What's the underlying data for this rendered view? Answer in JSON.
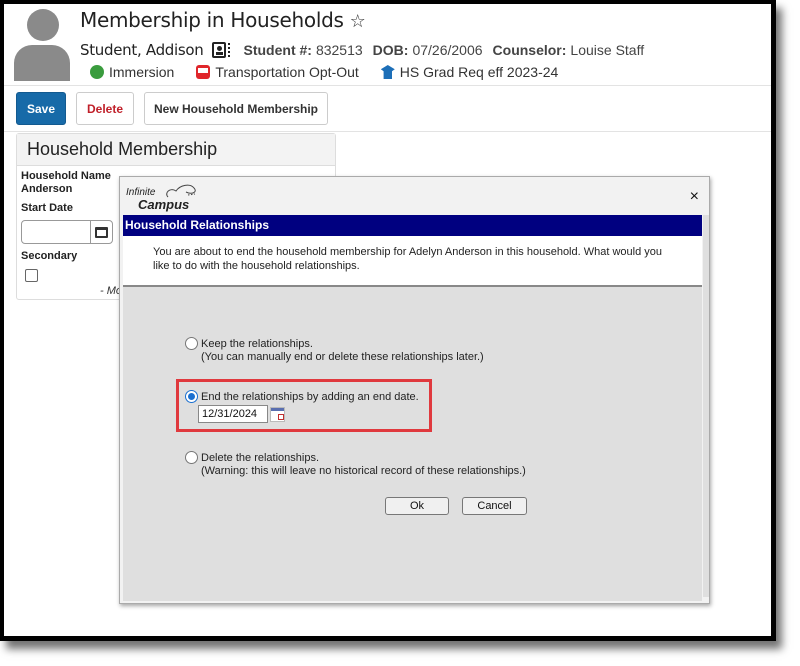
{
  "header": {
    "page_title": "Membership in Households",
    "favorite_icon": "star-outline-icon",
    "student_name": "Student, Addison",
    "student_number_label": "Student #:",
    "student_number": "832513",
    "dob_label": "DOB:",
    "dob": "07/26/2006",
    "counselor_label": "Counselor:",
    "counselor": "Louise Staff",
    "flags": [
      {
        "icon": "globe-icon",
        "label": "Immersion",
        "color": "#3a9c3e"
      },
      {
        "icon": "bus-icon",
        "label": "Transportation Opt-Out",
        "color": "#e0262b"
      },
      {
        "icon": "graduation-icon",
        "label": "HS Grad Req eff 2023-24",
        "color": "#1d6fb8"
      }
    ]
  },
  "toolbar": {
    "save_label": "Save",
    "delete_label": "Delete",
    "new_label": "New Household Membership"
  },
  "panel": {
    "title": "Household Membership",
    "household_name_label": "Household Name",
    "household_name_value": "Anderson",
    "start_date_label": "Start Date",
    "start_date_value": "",
    "secondary_label": "Secondary",
    "secondary_checked": false,
    "modified_text": "- Mo"
  },
  "dialog": {
    "logo_line1": "Infinite",
    "logo_line2": "Campus",
    "close_label": "×",
    "banner_title": "Household Relationships",
    "message": "You are about to end the household membership for Adelyn Anderson in this household. What would you like to do with the household relationships.",
    "options": [
      {
        "label": "Keep the relationships.",
        "sublabel": "(You can manually end or delete these relationships later.)",
        "selected": false
      },
      {
        "label": "End the relationships by adding an end date.",
        "sublabel": "",
        "selected": true
      },
      {
        "label": "Delete the relationships.",
        "sublabel": "(Warning: this will leave no historical record of these relationships.)",
        "selected": false
      }
    ],
    "end_date_value": "12/31/2024",
    "ok_label": "Ok",
    "cancel_label": "Cancel"
  },
  "colors": {
    "primary_button": "#176aa8",
    "delete_text": "#c0202a",
    "banner": "#000080",
    "highlight": "#e0393e",
    "radio_selected": "#1a6fd0"
  }
}
